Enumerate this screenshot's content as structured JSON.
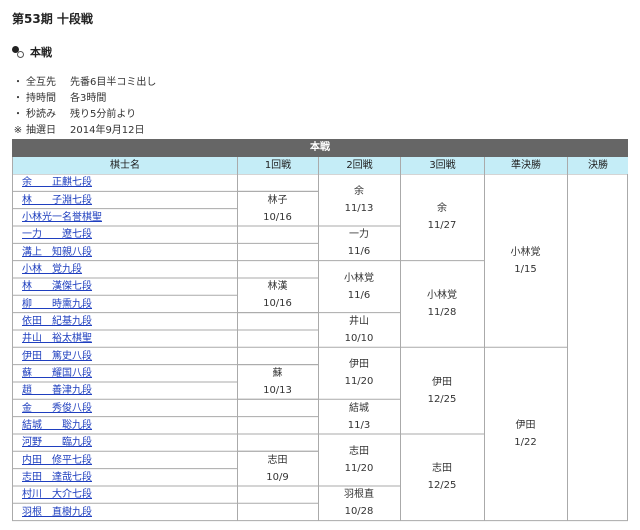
{
  "page_title": "第53期 十段戦",
  "section_heading": "本戦",
  "info": [
    {
      "marker": "・",
      "key": "全互先",
      "value": "先番6目半コミ出し"
    },
    {
      "marker": "・",
      "key": "持時間",
      "value": "各3時間"
    },
    {
      "marker": "・",
      "key": "秒読み",
      "value": "残り5分前より"
    },
    {
      "marker": "※",
      "key": "抽選日",
      "value": "2014年9月12日"
    }
  ],
  "bracket": {
    "title": "本戦",
    "headers": [
      "棋士名",
      "1回戦",
      "2回戦",
      "3回戦",
      "準決勝",
      "決勝"
    ],
    "players": [
      "余　　正麒七段",
      "林　　子淵七段",
      "小林光一名誉棋聖",
      "一力　　遼七段",
      "溝上　知親八段",
      "小林　覚九段",
      "林　　漢傑七段",
      "柳　　時熏九段",
      "依田　紀基九段",
      "井山　裕太棋聖",
      "伊田　篤史八段",
      "蘇　　耀国八段",
      "趙　　善津九段",
      "金　　秀俊八段",
      "結城　　聡九段",
      "河野　　臨九段",
      "内田　修平七段",
      "志田　達哉七段",
      "村川　大介七段",
      "羽根　直樹九段"
    ],
    "round1": [
      {
        "winner": "林子",
        "date": "10/16"
      },
      {
        "winner": "林漢",
        "date": "10/16"
      },
      {
        "winner": "蘇",
        "date": "10/13"
      },
      {
        "winner": "志田",
        "date": "10/9"
      }
    ],
    "round2": [
      {
        "winner": "余",
        "date": "11/13"
      },
      {
        "winner": "一力",
        "date": "11/6"
      },
      {
        "winner": "小林覚",
        "date": "11/6"
      },
      {
        "winner": "井山",
        "date": "10/10"
      },
      {
        "winner": "伊田",
        "date": "11/20"
      },
      {
        "winner": "結城",
        "date": "11/3"
      },
      {
        "winner": "志田",
        "date": "11/20"
      },
      {
        "winner": "羽根直",
        "date": "10/28"
      }
    ],
    "round3": [
      {
        "winner": "余",
        "date": "11/27"
      },
      {
        "winner": "小林覚",
        "date": "11/28"
      },
      {
        "winner": "伊田",
        "date": "12/25"
      },
      {
        "winner": "志田",
        "date": "12/25"
      }
    ],
    "semifinal": [
      {
        "winner": "小林覚",
        "date": "1/15"
      },
      {
        "winner": "伊田",
        "date": "1/22"
      }
    ],
    "final": []
  }
}
